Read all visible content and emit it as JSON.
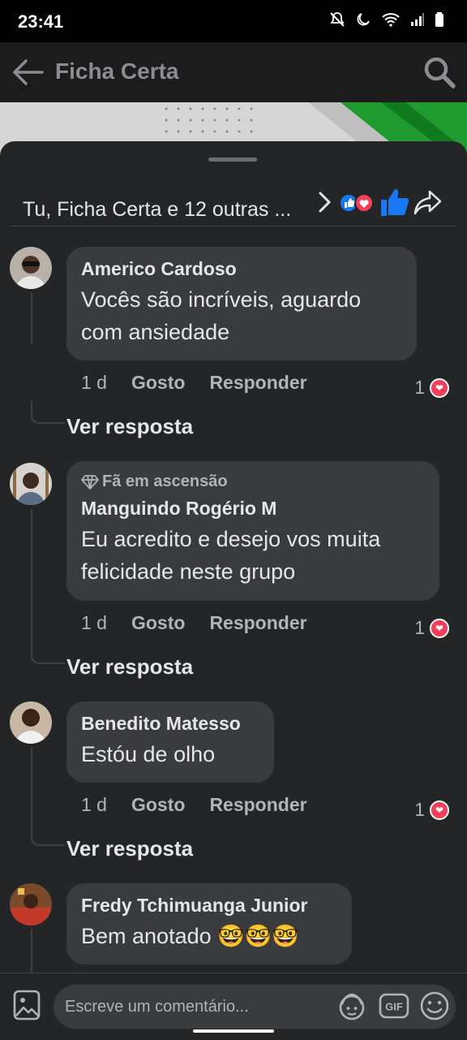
{
  "status_bar": {
    "time": "23:41"
  },
  "app_bar": {
    "title": "Ficha Certa"
  },
  "reactions_summary": {
    "text": "Tu, Ficha Certa e 12 outras ..."
  },
  "comments": [
    {
      "name": "Americo Cardoso",
      "badge": "",
      "lines": [
        "Vocês são incríveis, aguardo",
        "com ansiedade"
      ],
      "time": "1 d",
      "like_label": "Gosto",
      "reply_label": "Responder",
      "reaction_count": "1",
      "see_reply": "Ver resposta"
    },
    {
      "name": "Manguindo Rogério M",
      "badge": "Fã em ascensão",
      "lines": [
        "Eu acredito e desejo vos muita",
        "felicidade neste grupo"
      ],
      "time": "1 d",
      "like_label": "Gosto",
      "reply_label": "Responder",
      "reaction_count": "1",
      "see_reply": "Ver resposta"
    },
    {
      "name": "Benedito Matesso",
      "badge": "",
      "lines": [
        "Estóu de olho"
      ],
      "time": "1 d",
      "like_label": "Gosto",
      "reply_label": "Responder",
      "reaction_count": "1",
      "see_reply": "Ver resposta"
    },
    {
      "name": "Fredy Tchimuanga Junior",
      "badge": "",
      "lines": [
        "Bem anotado 🤓🤓🤓"
      ]
    }
  ],
  "composer": {
    "placeholder": "Escreve um comentário..."
  },
  "colors": {
    "background": "#242526",
    "bubble": "#3a3b3c",
    "like_blue": "#1877f2",
    "heart_red": "#f33e58"
  }
}
